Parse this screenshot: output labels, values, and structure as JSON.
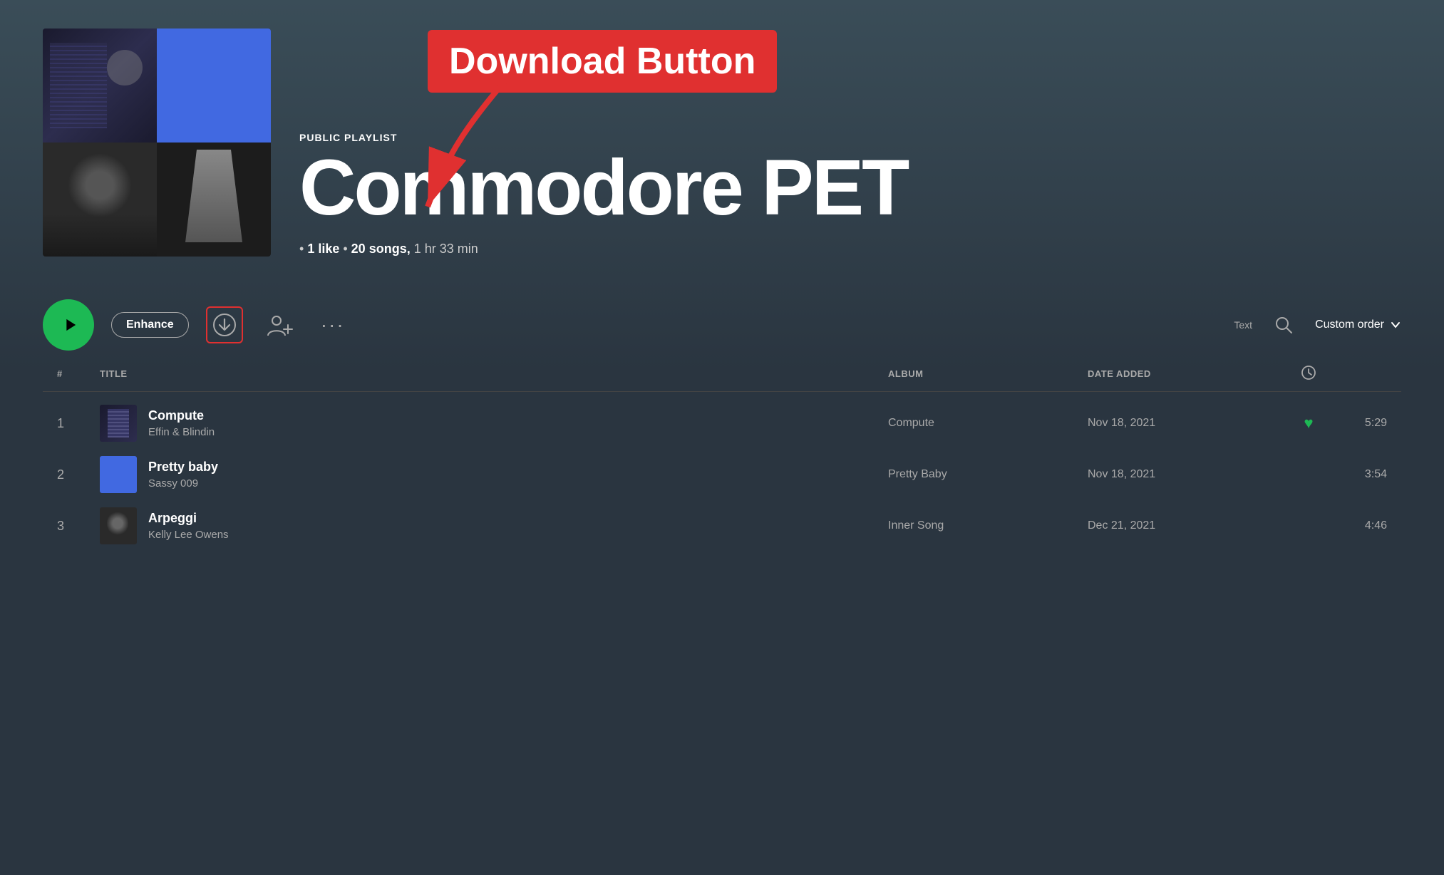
{
  "annotation": {
    "label": "Download Button"
  },
  "playlist": {
    "type": "PUBLIC PLAYLIST",
    "title": "Commodore PET",
    "likes": "1 like",
    "songs": "20 songs,",
    "duration": "1 hr 33 min"
  },
  "controls": {
    "play_label": "▶",
    "enhance_label": "Enhance",
    "text_label": "Text",
    "search_label": "🔍",
    "custom_order_label": "Custom order"
  },
  "table": {
    "headers": {
      "num": "#",
      "title": "TITLE",
      "album": "ALBUM",
      "date_added": "DATE ADDED",
      "duration_icon": "⏱"
    },
    "tracks": [
      {
        "num": "1",
        "name": "Compute",
        "artist": "Effin & Blindin",
        "album": "Compute",
        "date_added": "Nov 18, 2021",
        "liked": true,
        "duration": "5:29",
        "thumb_type": "1"
      },
      {
        "num": "2",
        "name": "Pretty baby",
        "artist": "Sassy 009",
        "album": "Pretty Baby",
        "date_added": "Nov 18, 2021",
        "liked": false,
        "duration": "3:54",
        "thumb_type": "2"
      },
      {
        "num": "3",
        "name": "Arpeggi",
        "artist": "Kelly Lee Owens",
        "album": "Inner Song",
        "date_added": "Dec 21, 2021",
        "liked": false,
        "duration": "4:46",
        "thumb_type": "3"
      }
    ]
  }
}
